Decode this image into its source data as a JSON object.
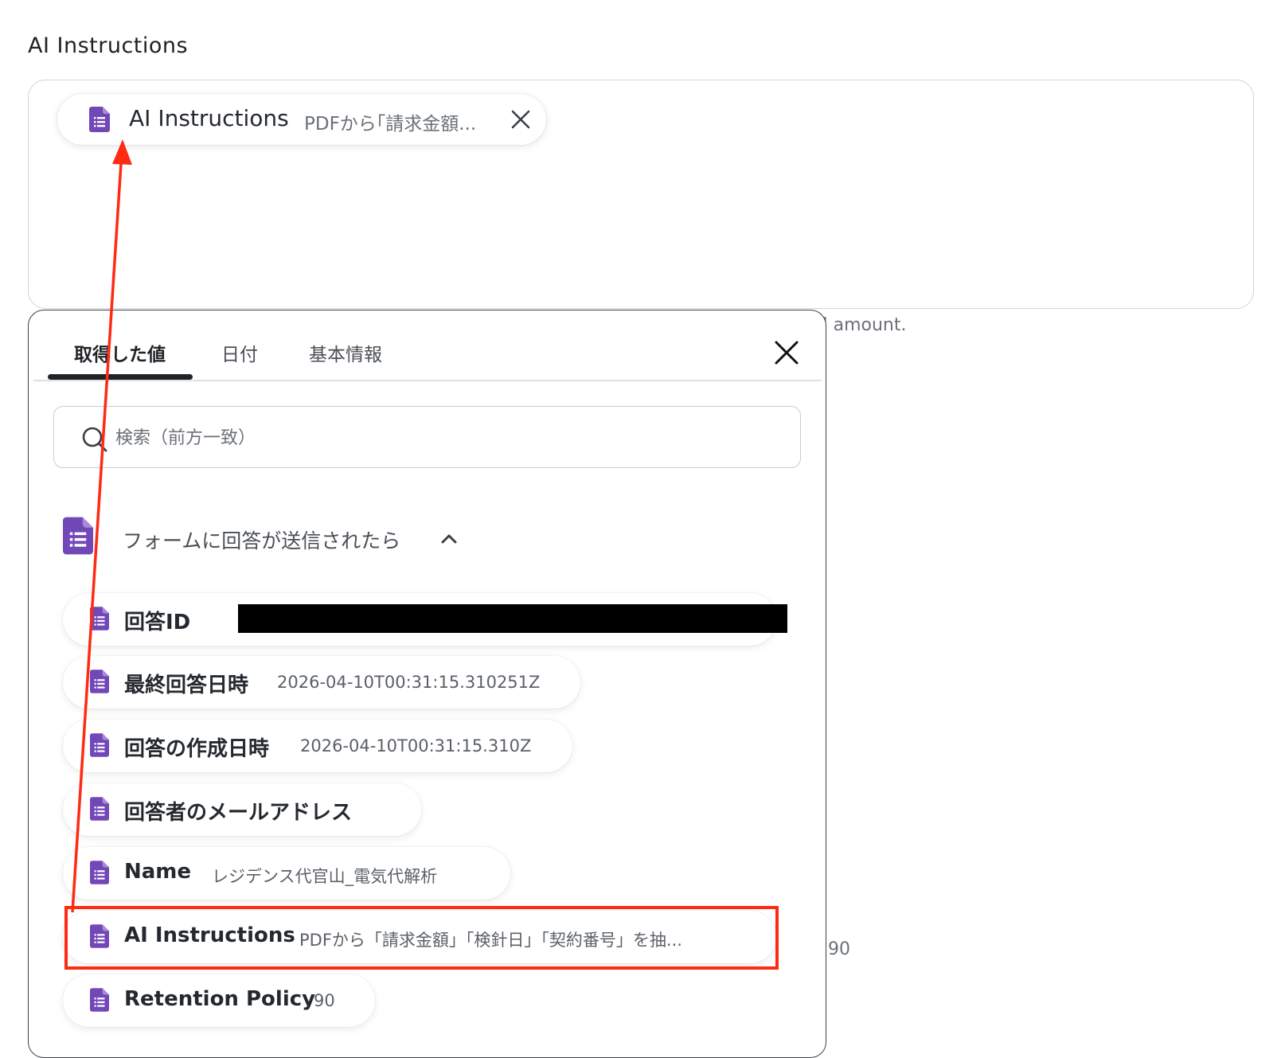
{
  "section_label": "AI Instructions",
  "chip": {
    "name": "AI Instructions",
    "value": "PDFから｢請求金額..."
  },
  "helper_text": "al amount.",
  "helper_number": "90",
  "panel": {
    "tabs": [
      {
        "label": "取得した値",
        "active": true
      },
      {
        "label": "日付",
        "active": false
      },
      {
        "label": "基本情報",
        "active": false
      }
    ],
    "search": {
      "placeholder": "検索（前方一致）",
      "value": ""
    },
    "group": {
      "title": "フォームに回答が送信されたら",
      "items": [
        {
          "name": "回答ID",
          "value": "",
          "redacted": true
        },
        {
          "name": "最終回答日時",
          "value": "2026-04-10T00:31:15.310251Z"
        },
        {
          "name": "回答の作成日時",
          "value": "2026-04-10T00:31:15.310Z"
        },
        {
          "name": "回答者のメールアドレス",
          "value": ""
        },
        {
          "name": "Name",
          "value": "レジデンス代官山_電気代解析"
        },
        {
          "name": "AI Instructions",
          "value": "PDFから「請求金額」「検針日」「契約番号」を抽...",
          "highlighted": true
        },
        {
          "name": "Retention Policy",
          "value": "90"
        }
      ]
    }
  },
  "colors": {
    "doc_icon": "#7248b9",
    "annotation": "#ff2a12",
    "text_primary": "#24292f",
    "text_muted": "#6b7078"
  },
  "icons": {
    "item": "google-forms-doc-icon",
    "close": "close-icon",
    "search": "search-icon",
    "collapse": "chevron-up-icon"
  }
}
